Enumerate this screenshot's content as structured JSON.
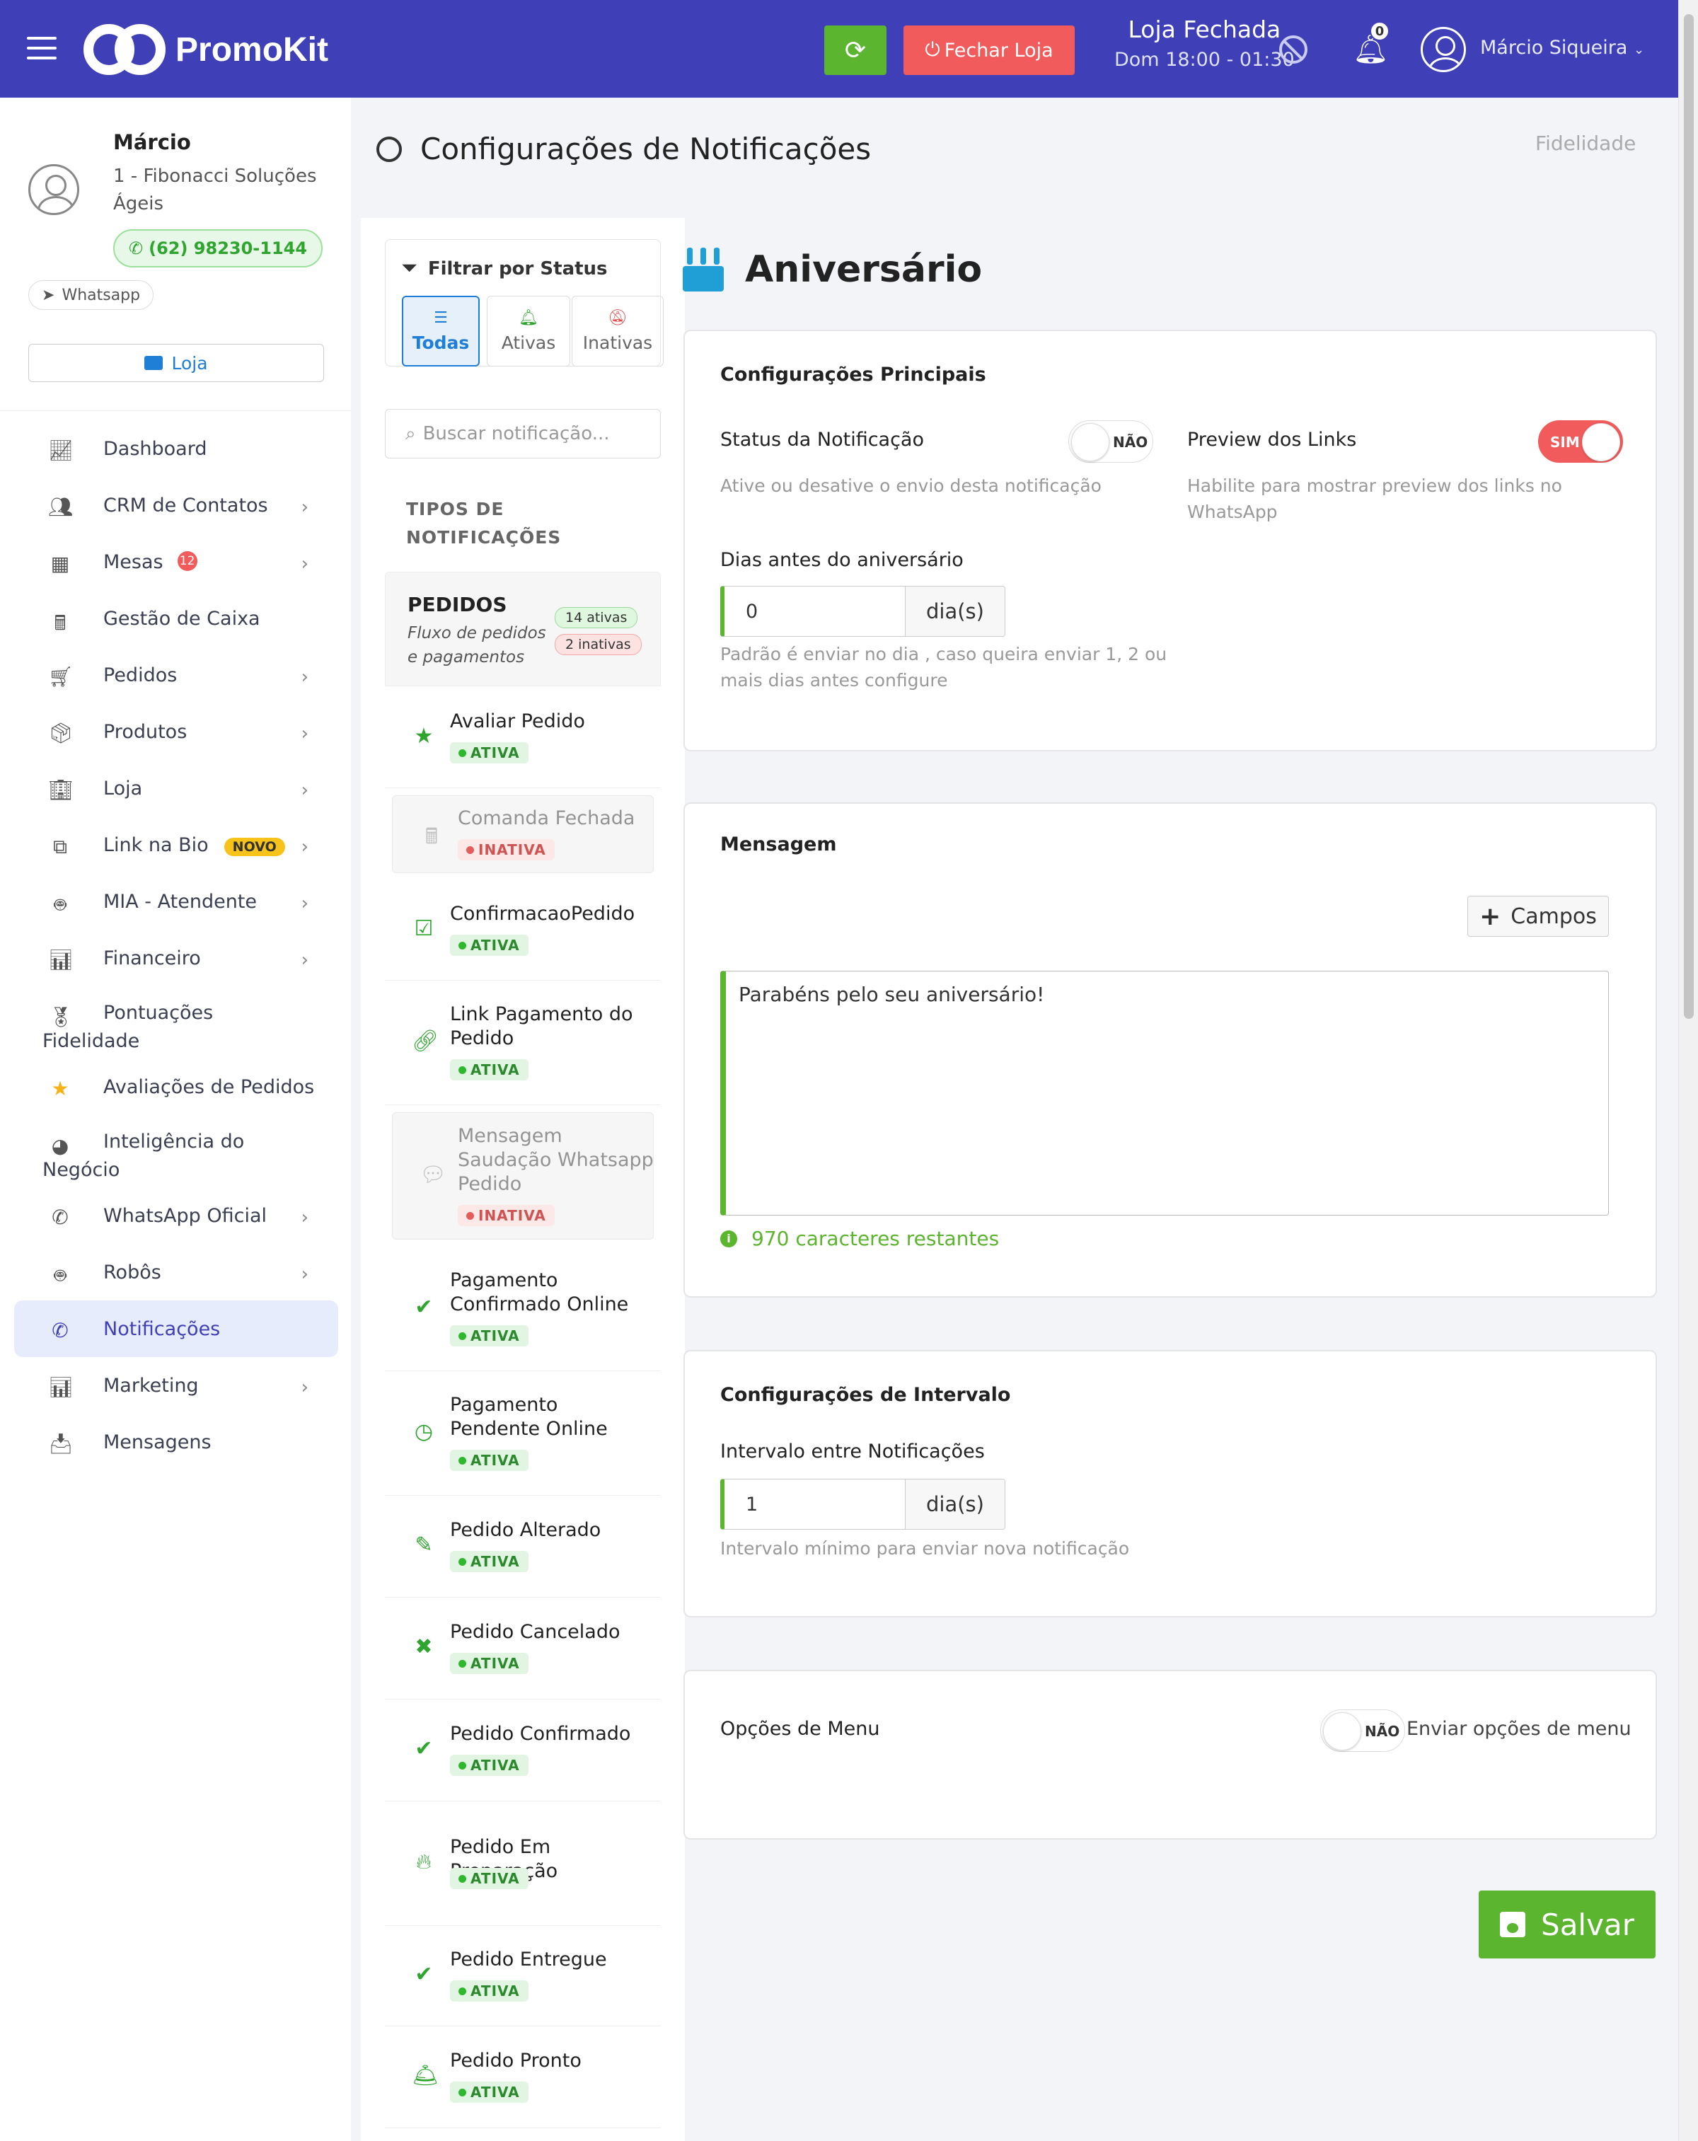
{
  "topbar": {
    "brand": "PromoKit",
    "close_store_label": "Fechar Loja",
    "store_state": "Loja Fechada",
    "store_hours": "Dom 18:00 - 01:30",
    "notifications_count": "0",
    "user_name": "Márcio Siqueira"
  },
  "profile": {
    "name": "Márcio",
    "company": "1 - Fibonacci Soluções Ágeis",
    "phone": "(62) 98230-1144",
    "whatsapp_label": "Whatsapp",
    "store_button": "Loja"
  },
  "menu": [
    {
      "label": "Dashboard",
      "icon": "chart-line-icon",
      "chevron": false
    },
    {
      "label": "CRM de Contatos",
      "icon": "users-icon",
      "chevron": true
    },
    {
      "label": "Mesas",
      "icon": "table-icon",
      "chevron": true,
      "badge": "12"
    },
    {
      "label": "Gestão de Caixa",
      "icon": "cash-register-icon",
      "chevron": false
    },
    {
      "label": "Pedidos",
      "icon": "cart-icon",
      "chevron": true
    },
    {
      "label": "Produtos",
      "icon": "box-icon",
      "chevron": true
    },
    {
      "label": "Loja",
      "icon": "building-icon",
      "chevron": true
    },
    {
      "label": "Link na Bio",
      "icon": "sitemap-icon",
      "chevron": true,
      "tag": "NOVO"
    },
    {
      "label": "MIA - Atendente",
      "icon": "robot-icon",
      "chevron": true
    },
    {
      "label": "Financeiro",
      "icon": "bar-chart-icon",
      "chevron": true
    },
    {
      "label": "Pontuações",
      "label2": "Fidelidade",
      "icon": "medal-icon",
      "chevron": false
    },
    {
      "label": "Avaliações de Pedidos",
      "icon": "star-icon",
      "chevron": false
    },
    {
      "label": "Inteligência do",
      "label2": "Negócio",
      "icon": "pie-chart-icon",
      "chevron": false
    },
    {
      "label": "WhatsApp Oficial",
      "icon": "whatsapp-icon",
      "chevron": true
    },
    {
      "label": "Robôs",
      "icon": "robot-icon",
      "chevron": true
    },
    {
      "label": "Notificações",
      "icon": "whatsapp-icon",
      "chevron": false,
      "active": true
    },
    {
      "label": "Marketing",
      "icon": "bar-chart-icon",
      "chevron": true
    },
    {
      "label": "Mensagens",
      "icon": "inbox-icon",
      "chevron": false
    }
  ],
  "page": {
    "title": "Configurações de Notificações",
    "breadcrumb": "Fidelidade"
  },
  "filter": {
    "title": "Filtrar por Status",
    "tabs": [
      "Todas",
      "Ativas",
      "Inativas"
    ],
    "search_placeholder": "Buscar notificação...",
    "types_label_1": "TIPOS DE",
    "types_label_2": "NOTIFICAÇÕES"
  },
  "category": {
    "title": "PEDIDOS",
    "subtitle": "Fluxo de pedidos e pagamentos",
    "active_count": "14 ativas",
    "inactive_count": "2 inativas"
  },
  "status_labels": {
    "active": "ATIVA",
    "inactive": "INATIVA"
  },
  "notifications": [
    {
      "name": "Avaliar Pedido",
      "active": true,
      "icon": "star-icon"
    },
    {
      "name": "Comanda Fechada",
      "active": false,
      "icon": "cash-register-icon"
    },
    {
      "name": "ConfirmacaoPedido",
      "active": true,
      "icon": "clipboard-check-icon"
    },
    {
      "name": "Link Pagamento do Pedido",
      "active": true,
      "icon": "link-icon"
    },
    {
      "name": "Mensagem Saudação Whatsapp Pedido",
      "active": false,
      "icon": "chat-icon"
    },
    {
      "name": "Pagamento Confirmado Online",
      "active": true,
      "icon": "check-circle-icon"
    },
    {
      "name": "Pagamento Pendente Online",
      "active": true,
      "icon": "clock-icon"
    },
    {
      "name": "Pedido Alterado",
      "active": true,
      "icon": "edit-icon"
    },
    {
      "name": "Pedido Cancelado",
      "active": true,
      "icon": "x-circle-icon"
    },
    {
      "name": "Pedido Confirmado",
      "active": true,
      "icon": "check-circle-icon"
    },
    {
      "name": "Pedido Em Preparação",
      "active": true,
      "icon": "fire-icon"
    },
    {
      "name": "Pedido Entregue",
      "active": true,
      "icon": "double-check-icon"
    },
    {
      "name": "Pedido Pronto",
      "active": true,
      "icon": "bell-service-icon"
    }
  ],
  "main": {
    "title": "Aniversário",
    "config": {
      "title": "Configurações Principais",
      "status_label": "Status da Notificação",
      "status_value": "NÃO",
      "status_help": "Ative ou desative o envio desta notificação",
      "preview_label": "Preview dos Links",
      "preview_value": "SIM",
      "preview_help_1": "Habilite para mostrar preview dos links no",
      "preview_help_2": "WhatsApp",
      "days_label": "Dias antes do aniversário",
      "days_value": "0",
      "days_unit": "dia(s)",
      "days_help_1": "Padrão é enviar no dia , caso queira enviar 1, 2 ou",
      "days_help_2": "mais dias antes configure"
    },
    "message": {
      "title": "Mensagem",
      "fields_button": "Campos",
      "text": "Parabéns pelo seu aniversário!",
      "remaining": "970 caracteres restantes"
    },
    "interval": {
      "title": "Configurações de Intervalo",
      "label": "Intervalo entre Notificações",
      "value": "1",
      "unit": "dia(s)",
      "help": "Intervalo mínimo para enviar nova notificação"
    },
    "menu_options": {
      "title": "Opções de Menu",
      "toggle_value": "NÃO",
      "toggle_label": "Enviar opções de menu"
    },
    "save_label": "Salvar"
  },
  "colors": {
    "topbar": "#3f3fb8",
    "accent_green": "#5cb52e",
    "danger": "#f15b5b",
    "link_blue": "#1f7fd6"
  }
}
